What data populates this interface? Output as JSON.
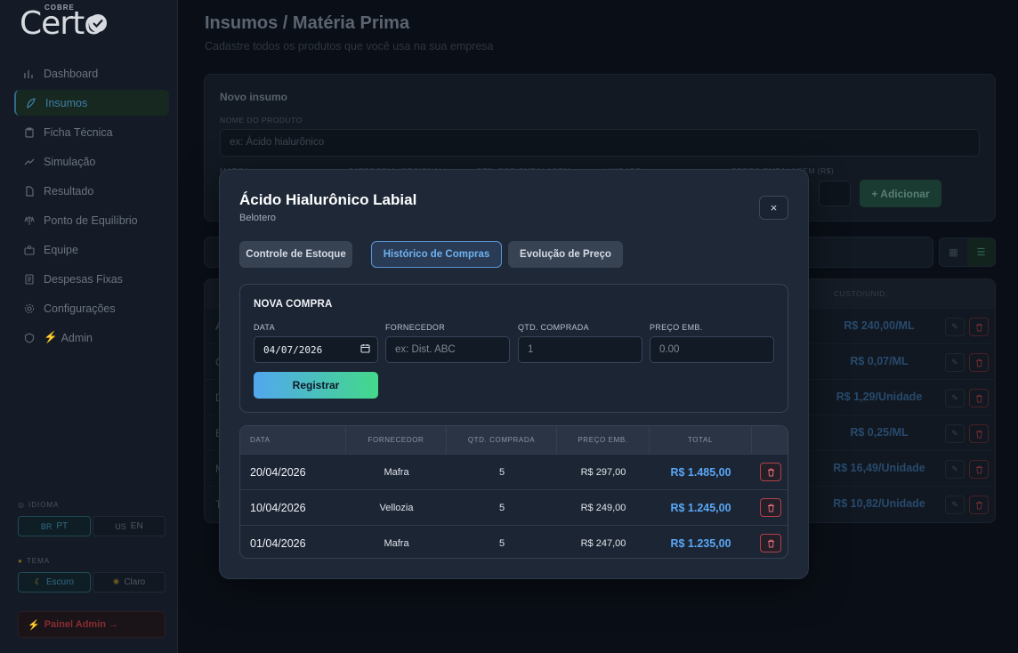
{
  "brand": {
    "top": "COBRE",
    "name": "Certo"
  },
  "sidebar": {
    "items": [
      {
        "label": "Dashboard",
        "icon": "chart-icon"
      },
      {
        "label": "Insumos",
        "icon": "leaf-icon"
      },
      {
        "label": "Ficha Técnica",
        "icon": "clipboard-icon"
      },
      {
        "label": "Simulação",
        "icon": "trend-icon"
      },
      {
        "label": "Resultado",
        "icon": "document-icon"
      },
      {
        "label": "Ponto de Equilíbrio",
        "icon": "scale-icon"
      },
      {
        "label": "Equipe",
        "icon": "team-icon"
      },
      {
        "label": "Despesas Fixas",
        "icon": "receipt-icon"
      },
      {
        "label": "Configurações",
        "icon": "gear-icon"
      },
      {
        "label": "Admin",
        "icon": "shield-icon"
      }
    ],
    "language_label": "IDIOMA",
    "lang_pt": "PT",
    "lang_en": "EN",
    "lang_pt_flag": "BR",
    "lang_en_flag": "US",
    "theme_label": "TEMA",
    "theme_dark": "Escuro",
    "theme_light": "Claro",
    "admin_panel": "Painel Admin →"
  },
  "page": {
    "title": "Insumos / Matéria Prima",
    "subtitle": "Cadastre todos os produtos que você usa na sua empresa"
  },
  "new_item": {
    "title": "Novo insumo",
    "name_label": "NOME DO PRODUTO",
    "name_placeholder": "ex: Ácido hialurônico",
    "second_row_labels": [
      "MARCA",
      "CATEGORIA (OPCIONAL)",
      "QTD. POR EMBALAGEM",
      "UNIDADE",
      "PREÇO EMBALAGEM (R$)"
    ],
    "add_button": "+ Adicionar"
  },
  "background_table": {
    "cost_header": "CUSTO/UNID.",
    "rows": [
      {
        "letter": "Á",
        "cost": "R$ 240,00/ML"
      },
      {
        "letter": "C",
        "cost": "R$ 0,07/ML"
      },
      {
        "letter": "D",
        "cost": "R$ 1,29/Unidade"
      },
      {
        "letter": "E",
        "cost": "R$ 0,25/ML"
      },
      {
        "letter": "M",
        "cost": "R$ 16,49/Unidade"
      },
      {
        "letter": "T",
        "cost": "R$ 10,82/Unidade"
      }
    ]
  },
  "modal": {
    "title": "Ácido Hialurônico Labial",
    "subtitle": "Belotero",
    "close": "×",
    "tabs": [
      "Controle de Estoque",
      "Histórico de Compras",
      "Evolução de Preço"
    ],
    "new_purchase": {
      "title": "NOVA COMPRA",
      "date_label": "DATA",
      "date_value": "04/07/2026",
      "supplier_label": "FORNECEDOR",
      "supplier_placeholder": "ex: Dist. ABC",
      "qty_label": "QTD. COMPRADA",
      "qty_value": "1",
      "price_label": "PREÇO EMB.",
      "price_placeholder": "0.00",
      "register_button": "Registrar"
    },
    "history": {
      "headers": [
        "DATA",
        "FORNECEDOR",
        "QTD. COMPRADA",
        "PREÇO EMB.",
        "TOTAL"
      ],
      "rows": [
        {
          "date": "20/04/2026",
          "supplier": "Mafra",
          "qty": "5",
          "price": "R$ 297,00",
          "total": "R$ 1.485,00"
        },
        {
          "date": "10/04/2026",
          "supplier": "Vellozia",
          "qty": "5",
          "price": "R$ 249,00",
          "total": "R$ 1.245,00"
        },
        {
          "date": "01/04/2026",
          "supplier": "Mafra",
          "qty": "5",
          "price": "R$ 247,00",
          "total": "R$ 1.235,00"
        }
      ]
    }
  }
}
